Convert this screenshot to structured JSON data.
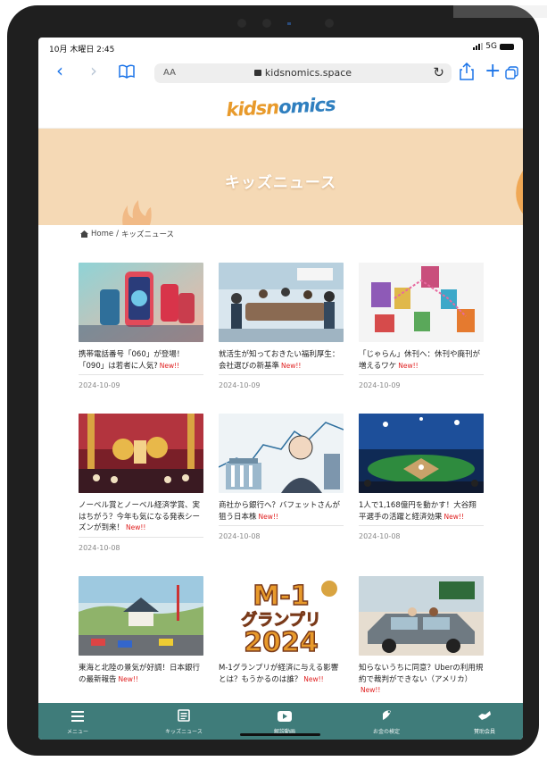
{
  "status_bar": {
    "time": "10月 木曜日 2:45",
    "network": "5G"
  },
  "browser": {
    "text_size_label": "AA",
    "url": "kidsnomics.space",
    "accent": "#1a73e8"
  },
  "site": {
    "logo_part1": "kidsn",
    "logo_part2": "omics",
    "page_title": "キッズニュース",
    "breadcrumb_home": "Home",
    "breadcrumb_sep": "/",
    "breadcrumb_current": "キッズニュース",
    "hero_color": "#f5d9b5"
  },
  "articles": [
    {
      "title": "携帯電話番号「060」が登場！「090」は若者に人気?",
      "new": "New!!",
      "date": "2024-10-09",
      "image": "phones-060-illustration"
    },
    {
      "title": "就活生が知っておきたい福利厚生：会社選びの新基準",
      "new": "New!!",
      "date": "2024-10-09",
      "image": "office-meeting-illustration"
    },
    {
      "title": "「じゃらん」休刊へ：休刊や廃刊が増えるワケ",
      "new": "New!!",
      "date": "2024-10-09",
      "image": "magazines-illustration"
    },
    {
      "title": "ノーベル賞とノーベル経済学賞、実はちがう？今年も気になる発表シーズンが到来！",
      "new": "New!!",
      "date": "2024-10-08",
      "image": "nobel-ceremony-illustration"
    },
    {
      "title": "商社から銀行へ？バフェットさんが狙う日本株",
      "new": "New!!",
      "date": "2024-10-08",
      "image": "buffett-stocks-illustration"
    },
    {
      "title": "1人で1,168億円を動かす！大谷翔平選手の活躍と経済効果",
      "new": "New!!",
      "date": "2024-10-08",
      "image": "baseball-stadium-illustration"
    },
    {
      "title": "東海と北陸の景気が好調！日本銀行の最新報告",
      "new": "New!!",
      "date": "",
      "image": "japan-castle-economy-illustration"
    },
    {
      "title": "M-1グランプリが経済に与える影響とは？もうかるのは誰？",
      "new": "New!!",
      "date": "",
      "image": "m1-grandprix-2024-logo",
      "image_text_1": "M-1",
      "image_text_2": "グランプリ",
      "image_text_3": "2024"
    },
    {
      "title": "知らないうちに同意？Uberの利用規約で裁判ができない（アメリカ）",
      "new": "New!!",
      "date": "",
      "image": "car-accident-illustration"
    }
  ],
  "tabbar": {
    "background": "#3f7c7a",
    "items": [
      {
        "label": "メニュー",
        "icon": "menu-icon"
      },
      {
        "label": "キッズニュース",
        "icon": "news-icon"
      },
      {
        "label": "解説動画",
        "icon": "video-icon"
      },
      {
        "label": "お金の検定",
        "icon": "quiz-icon"
      },
      {
        "label": "賛助会員",
        "icon": "supporter-icon"
      }
    ]
  }
}
